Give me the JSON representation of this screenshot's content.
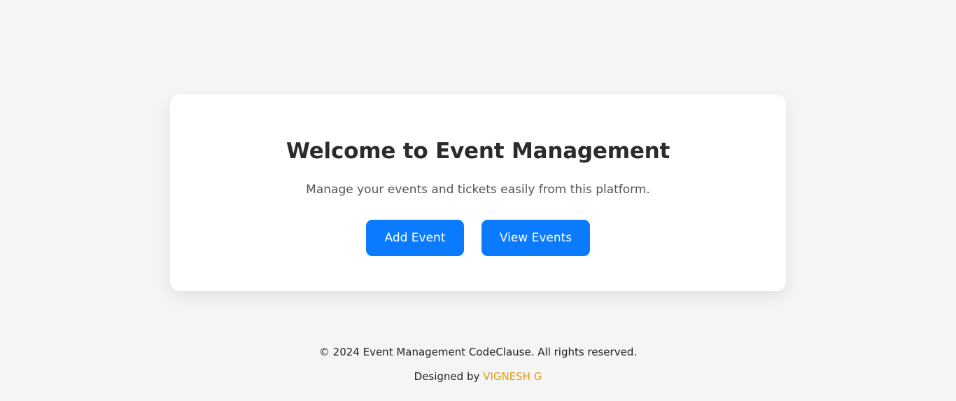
{
  "hero": {
    "title": "Welcome to Event Management",
    "subtitle": "Manage your events and tickets easily from this platform.",
    "add_button_label": "Add Event",
    "view_button_label": "View Events"
  },
  "footer": {
    "copyright": "© 2024 Event Management CodeClause. All rights reserved.",
    "designed_by_prefix": "Designed by",
    "designer_name": "VIGNESH G"
  },
  "colors": {
    "background": "#f4f5f4",
    "card": "#ffffff",
    "primary_button": "#0a7bff",
    "designer_accent": "#e29a12"
  }
}
